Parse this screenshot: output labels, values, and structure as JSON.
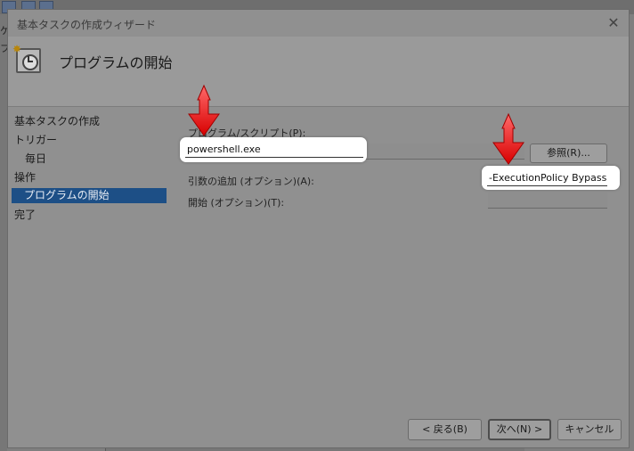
{
  "dialog": {
    "title": "基本タスクの作成ウィザード",
    "header_title": "プログラムの開始"
  },
  "nav": {
    "items": [
      {
        "label": "基本タスクの作成"
      },
      {
        "label": "トリガー"
      },
      {
        "label": "毎日"
      },
      {
        "label": "操作"
      },
      {
        "label": "プログラムの開始"
      },
      {
        "label": "完了"
      }
    ]
  },
  "form": {
    "program_label": "プログラム/スクリプト(P):",
    "program_value": "powershell.exe",
    "browse_label": "参照(R)...",
    "args_label": "引数の追加 (オプション)(A):",
    "args_value": "-ExecutionPolicy Bypass",
    "start_label": "開始 (オプション)(T):",
    "start_value": ""
  },
  "footer": {
    "back_label": "< 戻る(B)",
    "next_label": "次へ(N) >",
    "cancel_label": "キャンセル"
  },
  "background": {
    "left_chars": [
      "ケ",
      "フ"
    ]
  },
  "colors": {
    "selection": "#1d4f86",
    "arrow": "#e01010",
    "highlight": "#ffffff"
  },
  "icons": {
    "header": "scheduled-task-clock-icon",
    "close": "close-icon",
    "annotation": "red-arrow-icon"
  }
}
